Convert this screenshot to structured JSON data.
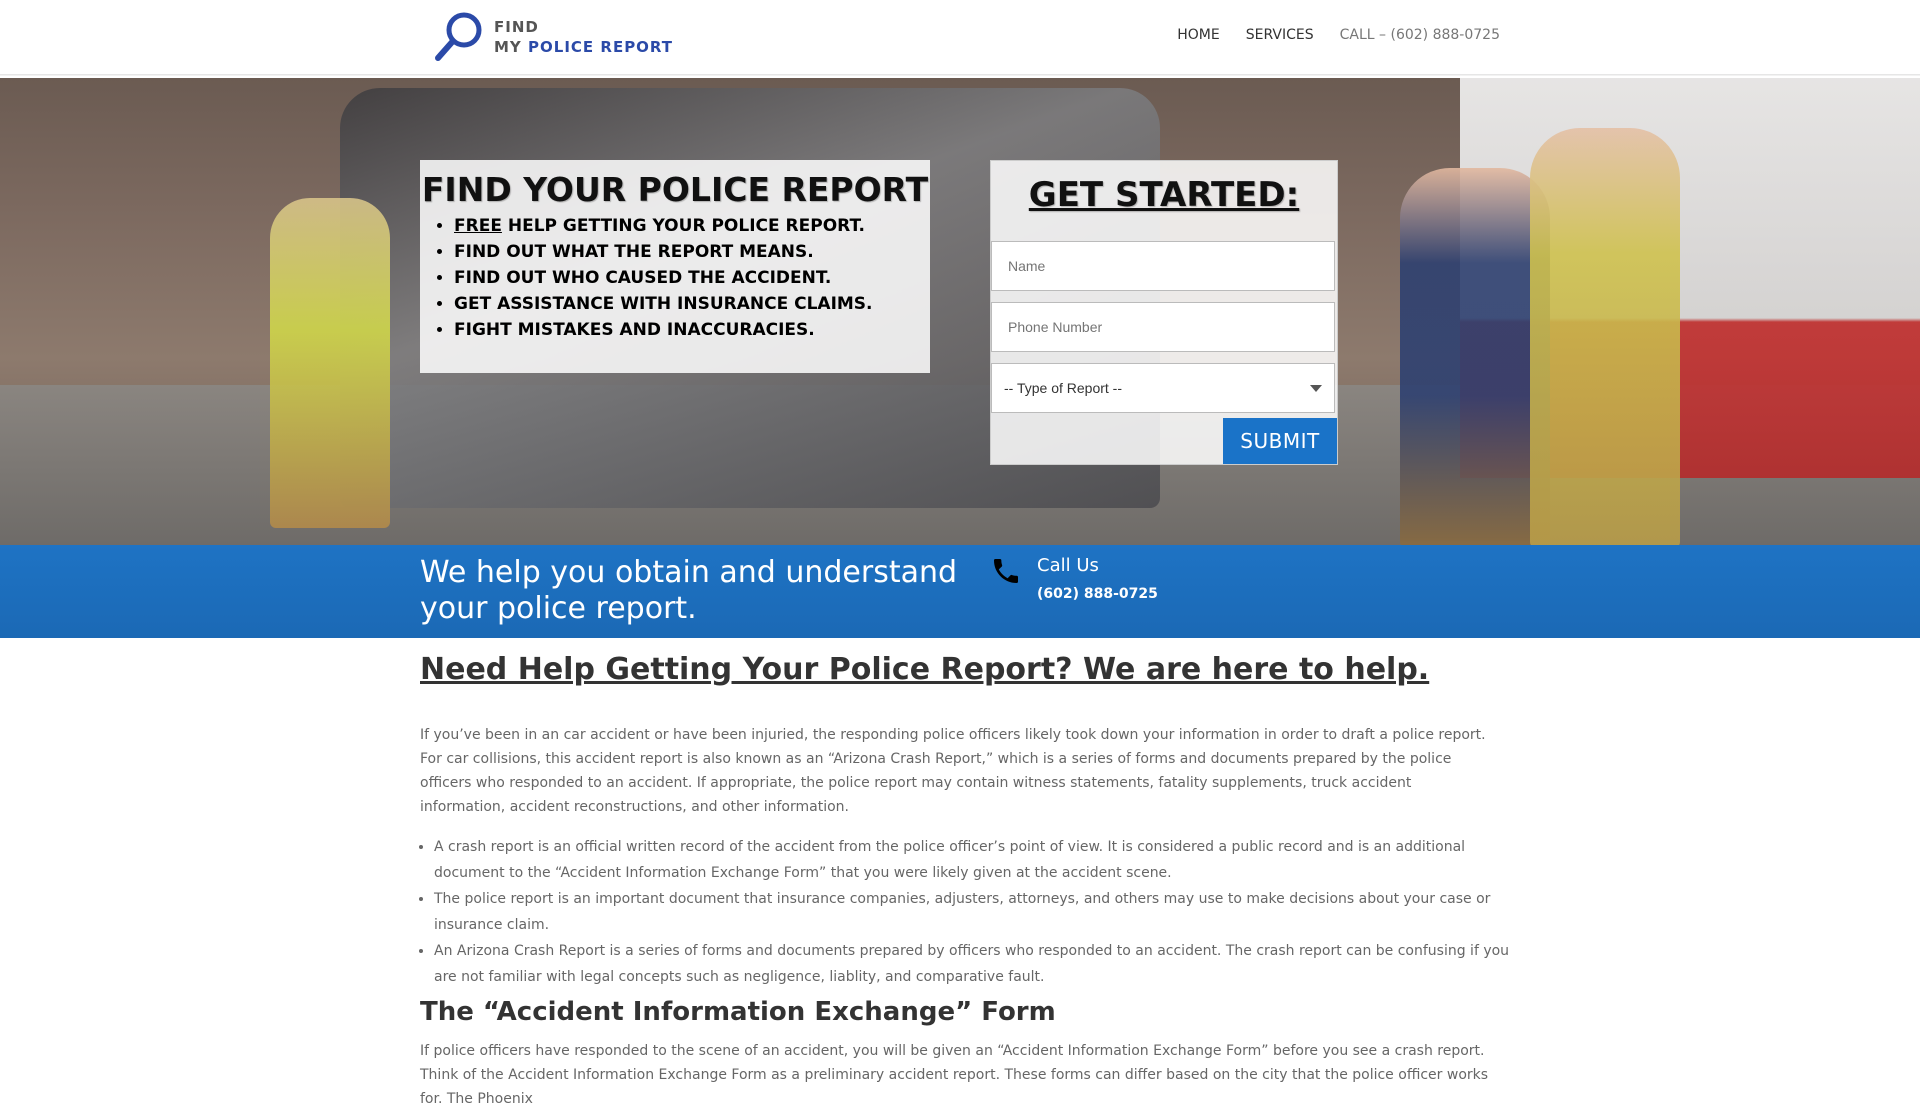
{
  "header": {
    "logo": {
      "line1": "FIND",
      "line2_prefix": "MY",
      "line2_accent": "POLICE REPORT"
    },
    "nav": [
      {
        "label": "HOME"
      },
      {
        "label": "SERVICES"
      },
      {
        "label": "CALL – (602) 888-0725"
      }
    ]
  },
  "hero": {
    "promo": {
      "title": "FIND YOUR POLICE REPORT",
      "items": [
        {
          "underlined": "FREE",
          "rest": " HELP GETTING YOUR POLICE REPORT."
        },
        {
          "underlined": "",
          "rest": "FIND OUT WHAT THE REPORT MEANS."
        },
        {
          "underlined": "",
          "rest": "FIND OUT WHO CAUSED THE ACCIDENT."
        },
        {
          "underlined": "",
          "rest": "GET ASSISTANCE WITH INSURANCE CLAIMS."
        },
        {
          "underlined": "",
          "rest": "FIGHT MISTAKES AND INACCURACIES."
        }
      ]
    },
    "form": {
      "title": "GET STARTED:",
      "name_placeholder": "Name",
      "phone_placeholder": "Phone Number",
      "select_value": "-- Type of Report --",
      "submit_label": "SUBMIT"
    }
  },
  "band": {
    "tagline": "We help you obtain and understand your police report.",
    "call_label": "Call Us",
    "call_number": "(602) 888-0725"
  },
  "content": {
    "heading": "Need Help Getting Your Police Report? We are here to help.",
    "paragraph1": "If you’ve been in an car accident or have been injuried, the responding police officers likely took down your information in order to draft a police report.  For car collisions, this accident report is also known as an “Arizona Crash Report,” which is a series of forms and documents prepared by the police officers who responded to an accident.  If appropriate, the police report may contain witness statements, fatality supplements, truck accident information, accident reconstructions, and other information.",
    "bullets": [
      "A crash report is an official written record of the accident from the police officer’s point of view. It is considered a public record and is an additional document to the “Accident Information Exchange Form” that you were likely given at the accident scene.",
      "The police report is an important document that insurance companies, adjusters, attorneys, and others may use to make decisions about your case or insurance claim.",
      "An Arizona Crash Report is a series of forms and documents prepared by officers who responded to an accident. The crash report can be confusing if you are not familiar with legal concepts such as negligence, liablity, and comparative fault."
    ],
    "subheading": "The “Accident Information Exchange” Form",
    "paragraph2": "If police officers have responded to the scene of an accident, you will be given an “Accident Information Exchange Form” before you see a crash report. Think of the Accident Information Exchange Form as a preliminary accident report. These forms can differ based on the city that the police officer works for. The Phoenix"
  }
}
